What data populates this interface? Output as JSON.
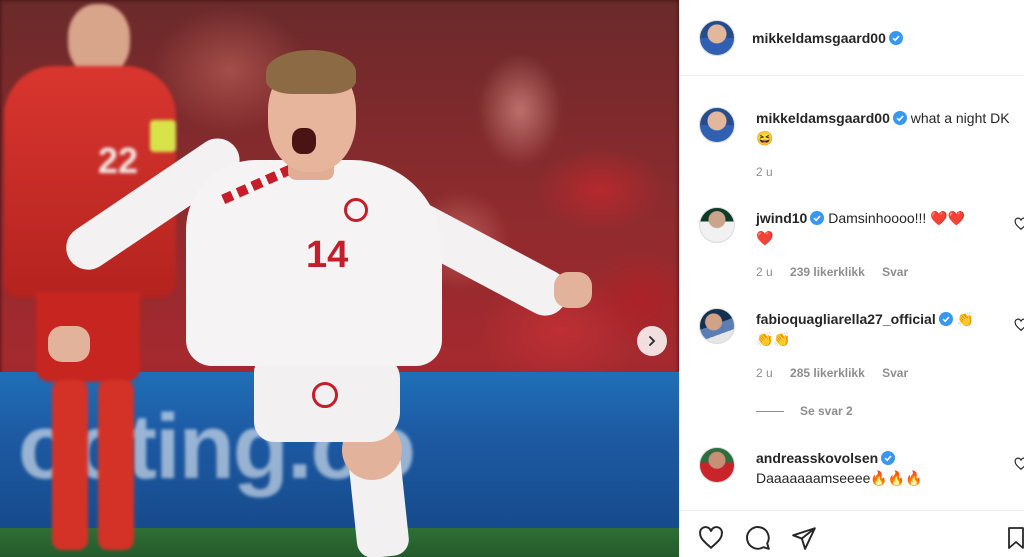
{
  "post": {
    "author": "mikkeldamsgaard00",
    "caption_text": "what a night DK",
    "caption_emoji": "😆",
    "caption_time": "2 u"
  },
  "photo": {
    "jersey_number": "14",
    "bg_jersey_number": "22",
    "board_text": "ooting.co"
  },
  "comments": [
    {
      "username": "jwind10",
      "verified": true,
      "text": "Damsinhoooo!!!",
      "emoji_line1": "❤️❤️",
      "emoji_line2": "❤️",
      "time": "2 u",
      "likes": "239 likerklikk",
      "reply": "Svar"
    },
    {
      "username": "fabioquagliarella27_official",
      "verified": true,
      "text": "",
      "emoji_line1": "👏",
      "emoji_line2": "👏👏",
      "time": "2 u",
      "likes": "285 likerklikk",
      "reply": "Svar",
      "view_replies": "Se svar 2"
    },
    {
      "username": "andreasskovolsen",
      "verified": true,
      "text": "Daaaaaaamseeee",
      "emoji_line1": "🔥🔥🔥"
    }
  ],
  "colors": {
    "verified": "#3897f0",
    "heart": "#ed4956",
    "text": "#262626",
    "meta": "#8e8e8e"
  },
  "icons": [
    "verified-badge-icon",
    "heart-icon",
    "comment-icon",
    "share-icon",
    "bookmark-icon",
    "chevron-right-icon"
  ]
}
